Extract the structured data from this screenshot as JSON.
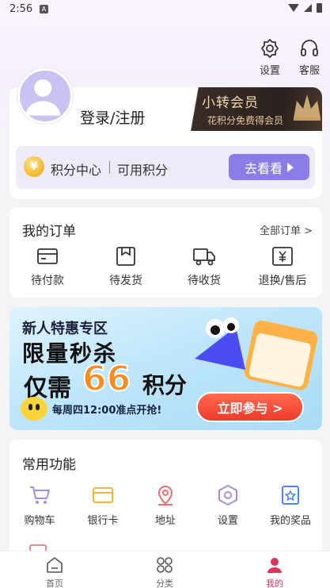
{
  "status_bar": {
    "time": "2:56",
    "notification_glyph": "A"
  },
  "header": {
    "settings_label": "设置",
    "service_label": "客服"
  },
  "profile": {
    "login_label": "登录/注册",
    "vip_title": "小转会员",
    "vip_subtitle": "花积分免费得会员"
  },
  "points": {
    "center_label": "积分中心",
    "available_label": "可用积分",
    "go_button_label": "去看看"
  },
  "orders": {
    "title": "我的订单",
    "all_link": "全部订单 >",
    "items": [
      {
        "label": "待付款",
        "icon": "wallet-icon"
      },
      {
        "label": "待发货",
        "icon": "box-icon"
      },
      {
        "label": "待收货",
        "icon": "truck-icon"
      },
      {
        "label": "退换/售后",
        "icon": "refund-icon"
      }
    ]
  },
  "promo": {
    "line1": "新人特惠专区",
    "line2": "限量秒杀",
    "line3_prefix": "仅需",
    "line3_number": "66",
    "line3_suffix": "积分",
    "note": "每周四12:00准点开抢!",
    "button_label": "立即参与 >"
  },
  "functions": {
    "title": "常用功能",
    "items": [
      {
        "label": "购物车",
        "icon": "cart-icon",
        "color": "#a58de6"
      },
      {
        "label": "银行卡",
        "icon": "card-icon",
        "color": "#f0b43a"
      },
      {
        "label": "地址",
        "icon": "location-icon",
        "color": "#ee6d6d"
      },
      {
        "label": "设置",
        "icon": "settings-hex-icon",
        "color": "#a58de6"
      },
      {
        "label": "我的奖品",
        "icon": "prize-icon",
        "color": "#4d86e8"
      }
    ]
  },
  "tabbar": {
    "items": [
      {
        "label": "首页",
        "icon": "home-icon"
      },
      {
        "label": "分类",
        "icon": "category-icon"
      },
      {
        "label": "我的",
        "icon": "user-icon",
        "active": true
      }
    ]
  },
  "colors": {
    "accent": "#8a7de8",
    "active_tab": "#e0315a",
    "promo_button": "#ee3a2d"
  }
}
